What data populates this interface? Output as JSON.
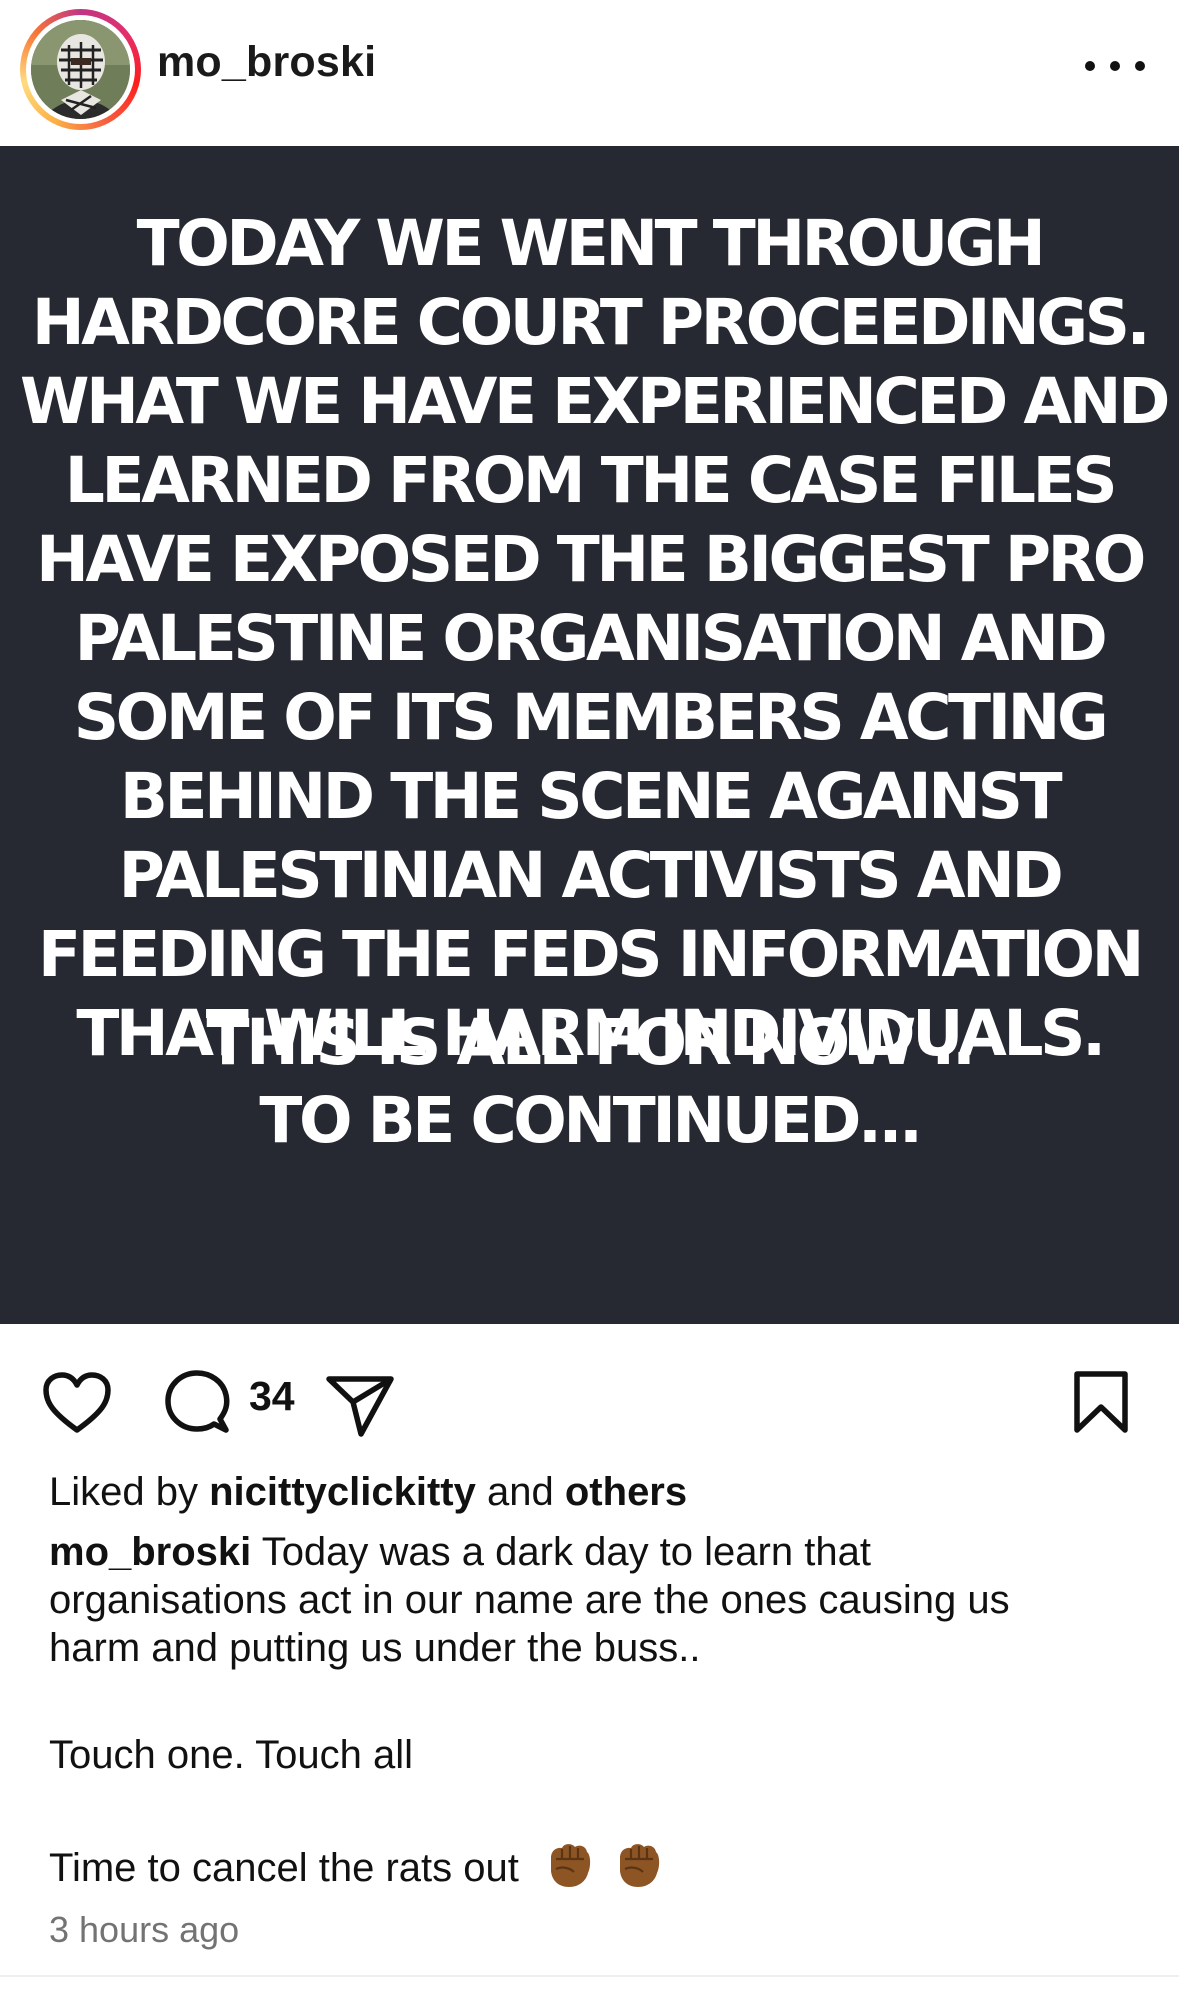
{
  "header": {
    "username": "mo_broski",
    "more_icon": "more-horizontal-icon"
  },
  "post_image": {
    "text_main": "TODAY WE WENT THROUGH\nHARDCORE COURT PROCEEDINGS.\nWHAT WE HAVE EXPERIENCED AND\nLEARNED FROM THE CASE FILES\nHAVE EXPOSED THE BIGGEST PRO\nPALESTINE ORGANISATION AND\nSOME OF ITS MEMBERS ACTING\nBEHIND THE SCENE AGAINST\nPALESTINIAN ACTIVISTS AND\nFEEDING THE FEDS INFORMATION\nTHAT WILL HARM INDIVIDUALS.",
    "text_end": "THIS IS ALL FOR NOW ..\nTO BE CONTINUED...",
    "background": "#262932"
  },
  "actions": {
    "like_icon": "heart-icon",
    "comment_icon": "comment-icon",
    "comment_count": "34",
    "share_icon": "send-icon",
    "save_icon": "bookmark-icon"
  },
  "likes": {
    "prefix": "Liked by",
    "user": "nicittyclickitty",
    "conjunction": "and",
    "others": "others"
  },
  "caption": {
    "username": "mo_broski",
    "line1": "Today was a dark day to learn that",
    "line2": "organisations act in our name are the ones causing us",
    "line3": "harm and putting us under the buss..",
    "line4": "Touch one. Touch all",
    "line5": "Time to cancel the rats out",
    "emoji": "✊🏾 ✊🏾"
  },
  "timestamp": "3 hours ago"
}
